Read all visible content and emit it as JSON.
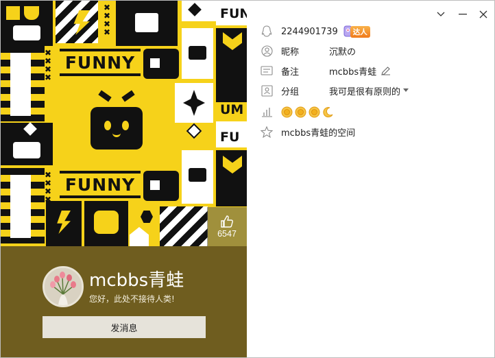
{
  "window_controls": {
    "dropdown_icon": "chevron-down-icon",
    "minimize_icon": "minimize-icon",
    "close_icon": "close-icon"
  },
  "cover": {
    "banner_text": "FUNNY",
    "side_text_top": "FUN",
    "side_text_mid": "UM",
    "side_text_low": "FU"
  },
  "profile": {
    "nickname": "mcbbs青蛙",
    "signature": "您好，此处不接待人类!",
    "like_count": "6547",
    "message_button": "发消息"
  },
  "info": {
    "qq_number": "2244901739",
    "badge_label": "达人",
    "nickname_label": "昵称",
    "nickname_value": "沉默の",
    "remark_label": "备注",
    "remark_value": "mcbbs青蛙",
    "group_label": "分组",
    "group_value": "我可是很有原则的",
    "level_icons": [
      "sun",
      "sun",
      "sun",
      "moon"
    ],
    "space_link": "mcbbs青蛙的空间"
  },
  "colors": {
    "cover_yellow": "#f6d21a",
    "panel_brown": "#6f5d1f",
    "badge_orange": "#f07a1c",
    "sun_gold": "#f2b01e"
  }
}
